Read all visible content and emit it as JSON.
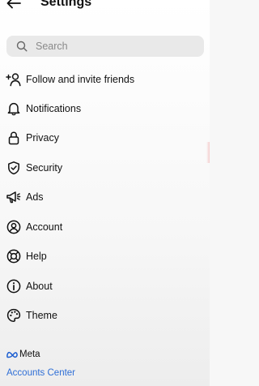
{
  "header": {
    "back_icon": "arrow-left-icon",
    "title": "Settings"
  },
  "search": {
    "icon": "search-icon",
    "placeholder": "Search",
    "value": ""
  },
  "menu": {
    "items": [
      {
        "label": "Follow and invite friends",
        "icon": "add-person-icon"
      },
      {
        "label": "Notifications",
        "icon": "bell-icon"
      },
      {
        "label": "Privacy",
        "icon": "lock-icon"
      },
      {
        "label": "Security",
        "icon": "shield-check-icon"
      },
      {
        "label": "Ads",
        "icon": "megaphone-icon"
      },
      {
        "label": "Account",
        "icon": "account-circle-icon"
      },
      {
        "label": "Help",
        "icon": "lifebuoy-icon"
      },
      {
        "label": "About",
        "icon": "info-icon"
      },
      {
        "label": "Theme",
        "icon": "palette-icon"
      }
    ]
  },
  "footer": {
    "brand": "Meta",
    "brand_icon": "meta-logo-icon",
    "link": "Accounts Center",
    "link_color": "#2f6fd6"
  }
}
